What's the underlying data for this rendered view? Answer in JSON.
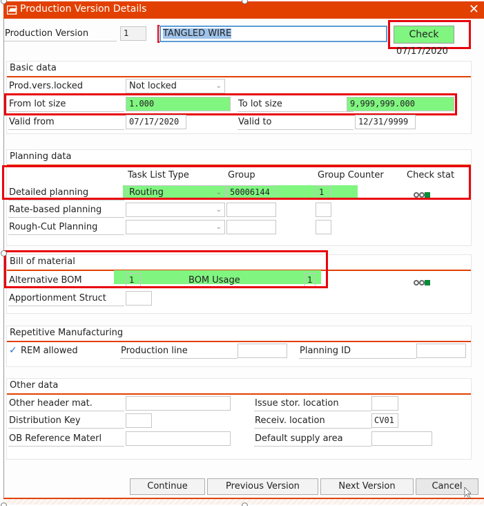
{
  "window": {
    "title": "Production Version Details",
    "close_label": "✕"
  },
  "header": {
    "prod_version_label": "Production Version",
    "prod_version_value": "1",
    "description_value": "TANGLED WIRE",
    "check_button": "Check",
    "check_date": "07/17/2020"
  },
  "basic_data": {
    "title": "Basic data",
    "locked_label": "Prod.vers.locked",
    "locked_value": "Not locked",
    "from_lot_label": "From lot size",
    "from_lot_value": "1.000",
    "to_lot_label": "To lot size",
    "to_lot_value": "9,999,999.000",
    "valid_from_label": "Valid from",
    "valid_from_value": "07/17/2020",
    "valid_to_label": "Valid to",
    "valid_to_value": "12/31/9999"
  },
  "planning_data": {
    "title": "Planning data",
    "columns": {
      "task_list_type": "Task List Type",
      "group": "Group",
      "group_counter": "Group Counter",
      "check_stat": "Check stat"
    },
    "rows": [
      {
        "label": "Detailed planning",
        "task_list_type": "Routing",
        "group": "50006144",
        "group_counter": "1",
        "status": "green"
      },
      {
        "label": "Rate-based planning",
        "task_list_type": "",
        "group": "",
        "group_counter": ""
      },
      {
        "label": "Rough-Cut Planning",
        "task_list_type": "",
        "group": "",
        "group_counter": ""
      }
    ]
  },
  "bom": {
    "title": "Bill of material",
    "alt_bom_label": "Alternative BOM",
    "alt_bom_value": "1",
    "bom_usage_label": "BOM Usage",
    "bom_usage_value": "1",
    "apportionment_label": "Apportionment Struct",
    "apportionment_value": "",
    "status": "green"
  },
  "repetitive": {
    "title": "Repetitive Manufacturing",
    "rem_allowed_label": "REM allowed",
    "rem_allowed": true,
    "production_line_label": "Production line",
    "production_line_value": "",
    "planning_id_label": "Planning ID",
    "planning_id_value": ""
  },
  "other_data": {
    "title": "Other data",
    "other_header_label": "Other header mat.",
    "other_header_value": "",
    "distribution_key_label": "Distribution Key",
    "distribution_key_value": "",
    "ob_reference_label": "OB Reference Materl",
    "ob_reference_value": "",
    "issue_stor_label": "Issue stor. location",
    "issue_stor_value": "",
    "receiv_label": "Receiv. location",
    "receiv_value": "CV01",
    "default_supply_label": "Default supply area",
    "default_supply_value": ""
  },
  "footer": {
    "continue": "Continue",
    "previous": "Previous Version",
    "next": "Next Version",
    "cancel": "Cancel"
  },
  "colors": {
    "titlebar": "#e24000",
    "highlight": "#80f580",
    "annotation_box": "#e8000b",
    "status_ok": "#0a8a3a"
  }
}
